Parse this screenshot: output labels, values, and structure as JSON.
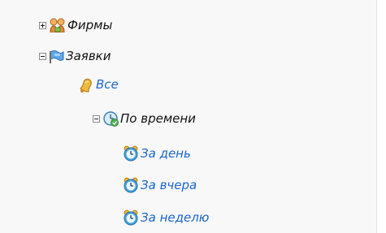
{
  "tree": {
    "firms": {
      "label": "Фирмы",
      "toggle": "plus",
      "icon": "firms-group-icon"
    },
    "requests": {
      "label": "Заявки",
      "toggle": "minus",
      "icon": "flag-icon"
    },
    "all": {
      "label": "Все",
      "icon": "bell-icon"
    },
    "by_time": {
      "label": "По времени",
      "toggle": "minus",
      "icon": "clock-refresh-icon"
    },
    "day": {
      "label": "За день",
      "icon": "alarm-clock-icon"
    },
    "yesterday": {
      "label": "За вчера",
      "icon": "alarm-clock-icon"
    },
    "week": {
      "label": "За неделю",
      "icon": "alarm-clock-icon"
    }
  },
  "colors": {
    "leaf_link": "#1a66c8",
    "branch_text": "#111111",
    "panel_bg": "#f8f8f8"
  }
}
